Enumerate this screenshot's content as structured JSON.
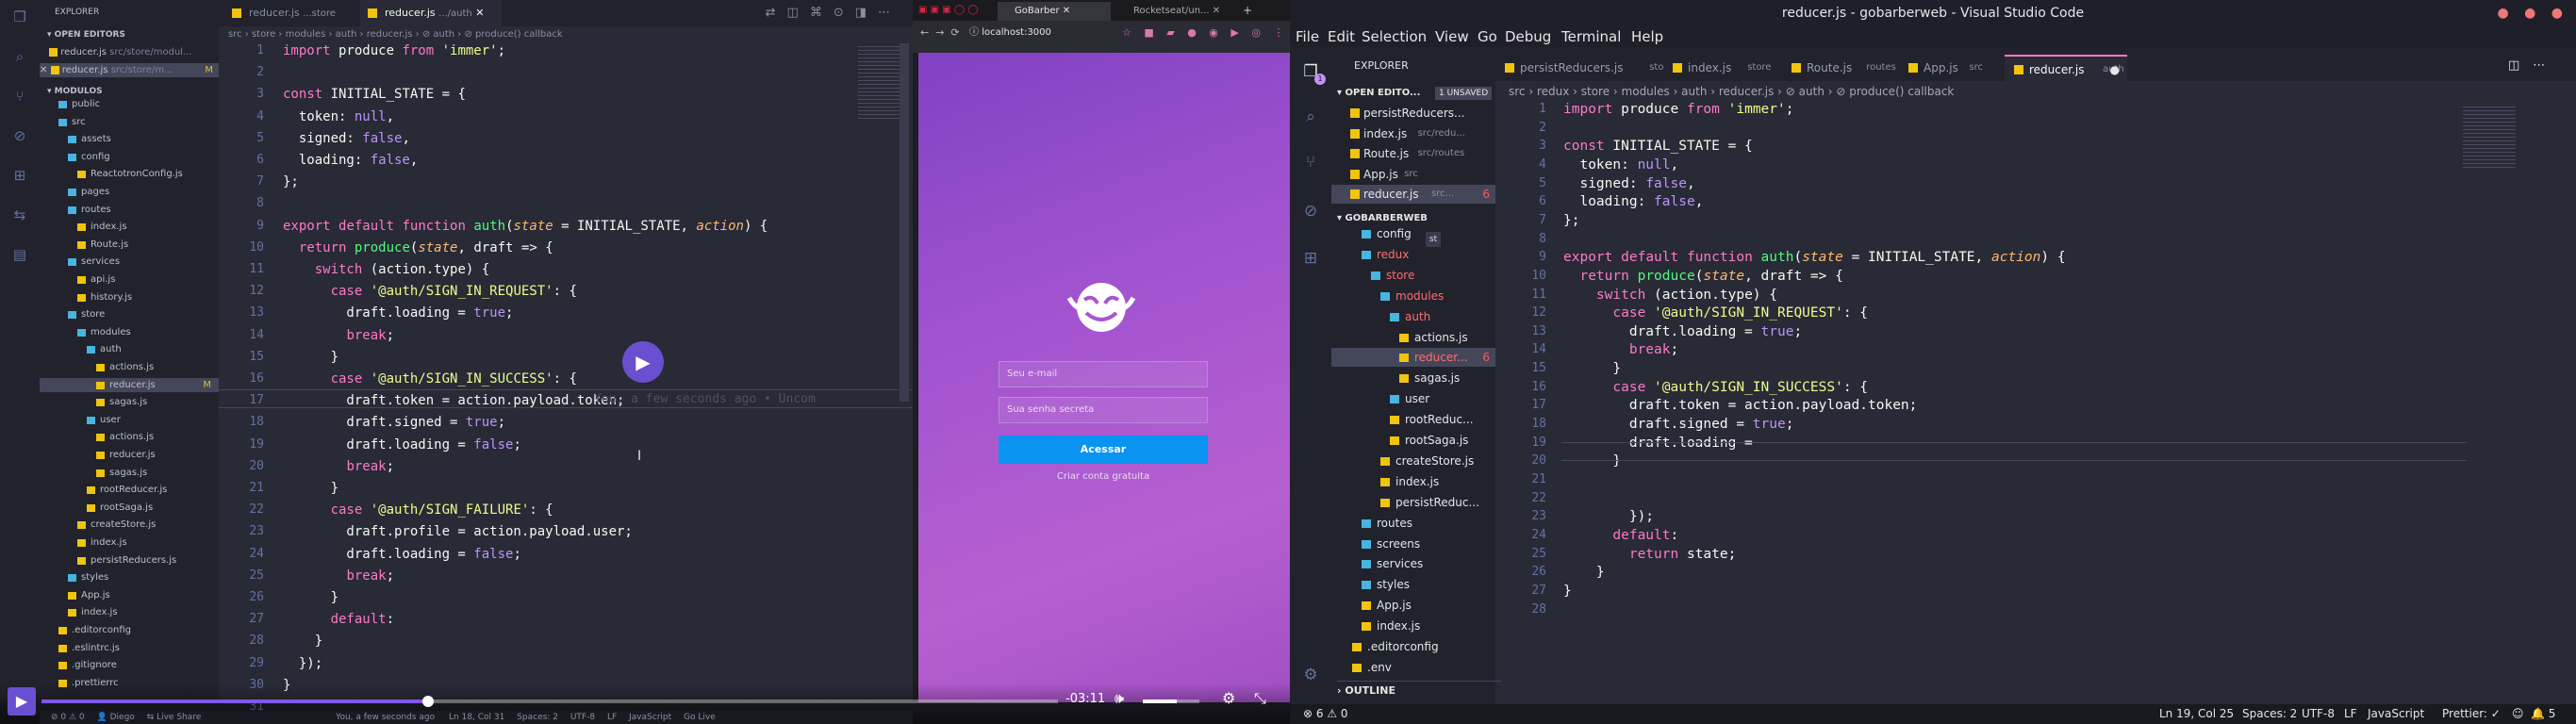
{
  "left_editor": {
    "explorer_title": "EXPLORER",
    "open_editors_label": "OPEN EDITORS",
    "open_files": [
      {
        "name": "reducer.js",
        "path": "src/store/modul..."
      },
      {
        "name": "reducer.js",
        "path": "src/store/m...",
        "badge": "M"
      }
    ],
    "project_label": "MODULOS",
    "tree": [
      {
        "name": "public",
        "kind": "folder",
        "depth": 1
      },
      {
        "name": "src",
        "kind": "folder",
        "depth": 1
      },
      {
        "name": "assets",
        "kind": "folder",
        "depth": 2
      },
      {
        "name": "config",
        "kind": "folder",
        "depth": 2
      },
      {
        "name": "ReactotronConfig.js",
        "kind": "file",
        "depth": 3
      },
      {
        "name": "pages",
        "kind": "folder",
        "depth": 2
      },
      {
        "name": "routes",
        "kind": "folder",
        "depth": 2
      },
      {
        "name": "index.js",
        "kind": "file",
        "depth": 3
      },
      {
        "name": "Route.js",
        "kind": "file",
        "depth": 3
      },
      {
        "name": "services",
        "kind": "folder",
        "depth": 2
      },
      {
        "name": "api.js",
        "kind": "file",
        "depth": 3
      },
      {
        "name": "history.js",
        "kind": "file",
        "depth": 3
      },
      {
        "name": "store",
        "kind": "folder",
        "depth": 2
      },
      {
        "name": "modules",
        "kind": "folder",
        "depth": 3
      },
      {
        "name": "auth",
        "kind": "folder",
        "depth": 4
      },
      {
        "name": "actions.js",
        "kind": "file",
        "depth": 5
      },
      {
        "name": "reducer.js",
        "kind": "file",
        "depth": 5,
        "badge": "M"
      },
      {
        "name": "sagas.js",
        "kind": "file",
        "depth": 5
      },
      {
        "name": "user",
        "kind": "folder",
        "depth": 4
      },
      {
        "name": "actions.js",
        "kind": "file",
        "depth": 5
      },
      {
        "name": "reducer.js",
        "kind": "file",
        "depth": 5
      },
      {
        "name": "sagas.js",
        "kind": "file",
        "depth": 5
      },
      {
        "name": "rootReducer.js",
        "kind": "file",
        "depth": 4
      },
      {
        "name": "rootSaga.js",
        "kind": "file",
        "depth": 4
      },
      {
        "name": "createStore.js",
        "kind": "file",
        "depth": 3
      },
      {
        "name": "index.js",
        "kind": "file",
        "depth": 3
      },
      {
        "name": "persistReducers.js",
        "kind": "file",
        "depth": 3
      },
      {
        "name": "styles",
        "kind": "folder",
        "depth": 2
      },
      {
        "name": "App.js",
        "kind": "file",
        "depth": 2
      },
      {
        "name": "index.js",
        "kind": "file",
        "depth": 2
      },
      {
        "name": ".editorconfig",
        "kind": "file",
        "depth": 1
      },
      {
        "name": ".eslintrc.js",
        "kind": "file",
        "depth": 1
      },
      {
        "name": ".gitignore",
        "kind": "file",
        "depth": 1
      },
      {
        "name": ".prettierrc",
        "kind": "file",
        "depth": 1
      }
    ],
    "tabs": [
      {
        "name": "reducer.js",
        "path": "...store"
      },
      {
        "name": "reducer.js",
        "path": ".../auth"
      }
    ],
    "breadcrumb": "src › store › modules › auth › reducer.js › ⊘ auth › ⊘ produce() callback",
    "blame": "You, a few seconds ago • Uncom",
    "code": [
      "import produce from 'immer';",
      "",
      "const INITIAL_STATE = {",
      "  token: null,",
      "  signed: false,",
      "  loading: false,",
      "};",
      "",
      "export default function auth(state = INITIAL_STATE, action) {",
      "  return produce(state, draft => {",
      "    switch (action.type) {",
      "      case '@auth/SIGN_IN_REQUEST': {",
      "        draft.loading = true;",
      "        break;",
      "      }",
      "      case '@auth/SIGN_IN_SUCCESS': {",
      "        draft.token = action.payload.token;",
      "        draft.signed = true;",
      "        draft.loading = false;",
      "        break;",
      "      }",
      "      case '@auth/SIGN_FAILURE': {",
      "        draft.profile = action.payload.user;",
      "        draft.loading = false;",
      "        break;",
      "      }",
      "      default:",
      "    }",
      "  });",
      "}",
      ""
    ],
    "status": {
      "user": "Diego",
      "live_share": "Live Share",
      "blame": "You, a few seconds ago",
      "position": "Ln 18, Col 31",
      "spaces": "Spaces: 2",
      "encoding": "UTF-8",
      "eol": "LF",
      "language": "JavaScript",
      "golive": "Go Live"
    }
  },
  "video": {
    "time": "-03:11",
    "progress": 0.38,
    "volume": 0.6
  },
  "browser": {
    "tabs": [
      "GoBarber",
      "Rocketseat/un..."
    ],
    "url": "localhost:3000",
    "email_placeholder": "Seu e-mail",
    "password_placeholder": "Sua senha secreta",
    "submit_label": "Acessar",
    "link_label": "Criar conta gratuita"
  },
  "right_editor": {
    "window_title": "reducer.js - gobarberweb - Visual Studio Code",
    "menu": [
      "File",
      "Edit",
      "Selection",
      "View",
      "Go",
      "Debug",
      "Terminal",
      "Help"
    ],
    "explorer_title": "EXPLORER",
    "open_editors_label": "OPEN EDITO...",
    "unsaved_label": "1 UNSAVED",
    "open_files": [
      {
        "name": "persistReducers...",
        "path": ""
      },
      {
        "name": "index.js",
        "path": "src/redu..."
      },
      {
        "name": "Route.js",
        "path": "src/routes"
      },
      {
        "name": "App.js",
        "path": "src"
      },
      {
        "name": "reducer.js",
        "path": "src...",
        "badge": "6"
      }
    ],
    "project_label": "GOBARBERWEB",
    "tree": [
      {
        "name": "config",
        "depth": 2,
        "kind": "folder"
      },
      {
        "name": "redux",
        "depth": 2,
        "kind": "folder"
      },
      {
        "name": "store",
        "depth": 3,
        "kind": "folder"
      },
      {
        "name": "modules",
        "depth": 4,
        "kind": "folder"
      },
      {
        "name": "auth",
        "depth": 5,
        "kind": "folder"
      },
      {
        "name": "actions.js",
        "depth": 6,
        "kind": "file"
      },
      {
        "name": "reducer...",
        "depth": 6,
        "kind": "file",
        "badge": "6"
      },
      {
        "name": "sagas.js",
        "depth": 6,
        "kind": "file"
      },
      {
        "name": "user",
        "depth": 5,
        "kind": "folder"
      },
      {
        "name": "rootReduc...",
        "depth": 5,
        "kind": "file"
      },
      {
        "name": "rootSaga.js",
        "depth": 5,
        "kind": "file"
      },
      {
        "name": "createStore.js",
        "depth": 4,
        "kind": "file"
      },
      {
        "name": "index.js",
        "depth": 4,
        "kind": "file"
      },
      {
        "name": "persistReduc...",
        "depth": 4,
        "kind": "file"
      },
      {
        "name": "routes",
        "depth": 2,
        "kind": "folder"
      },
      {
        "name": "screens",
        "depth": 2,
        "kind": "folder"
      },
      {
        "name": "services",
        "depth": 2,
        "kind": "folder"
      },
      {
        "name": "styles",
        "depth": 2,
        "kind": "folder"
      },
      {
        "name": "App.js",
        "depth": 2,
        "kind": "file"
      },
      {
        "name": "index.js",
        "depth": 2,
        "kind": "file"
      },
      {
        "name": ".editorconfig",
        "depth": 1,
        "kind": "file"
      },
      {
        "name": ".env",
        "depth": 1,
        "kind": "file"
      }
    ],
    "outline_label": "OUTLINE",
    "tabs": [
      {
        "name": "persistReducers.js",
        "path": "store"
      },
      {
        "name": "index.js",
        "path": "store"
      },
      {
        "name": "Route.js",
        "path": "routes"
      },
      {
        "name": "App.js",
        "path": "src"
      },
      {
        "name": "reducer.js",
        "path": "auth"
      }
    ],
    "breadcrumb": "src › redux › store › modules › auth › reducer.js › ⊘ auth › ⊘ produce() callback",
    "code": [
      "import produce from 'immer';",
      "",
      "const INITIAL_STATE = {",
      "  token: null,",
      "  signed: false,",
      "  loading: false,",
      "};",
      "",
      "export default function auth(state = INITIAL_STATE, action) {",
      "  return produce(state, draft => {",
      "    switch (action.type) {",
      "      case '@auth/SIGN_IN_REQUEST': {",
      "        draft.loading = true;",
      "        break;",
      "      }",
      "      case '@auth/SIGN_IN_SUCCESS': {",
      "        draft.token = action.payload.token;",
      "        draft.signed = true;",
      "        draft.loading =",
      "      }",
      "",
      "",
      "        });",
      "      default:",
      "        return state;",
      "    }",
      "}",
      ""
    ],
    "status": {
      "problems": "6",
      "warnings": "0",
      "position": "Ln 19, Col 25",
      "spaces": "Spaces: 2",
      "encoding": "UTF-8",
      "eol": "LF",
      "language": "JavaScript",
      "prettier": "Prettier: ✓",
      "bell": "5"
    }
  },
  "colors": {
    "accent": "#6272a4",
    "pink": "#ff79c6",
    "green": "#50fa7b",
    "yellow": "#f1fa8c",
    "orange": "#ffb86c",
    "purple": "#bd93f9",
    "button": "#0a93f0"
  }
}
